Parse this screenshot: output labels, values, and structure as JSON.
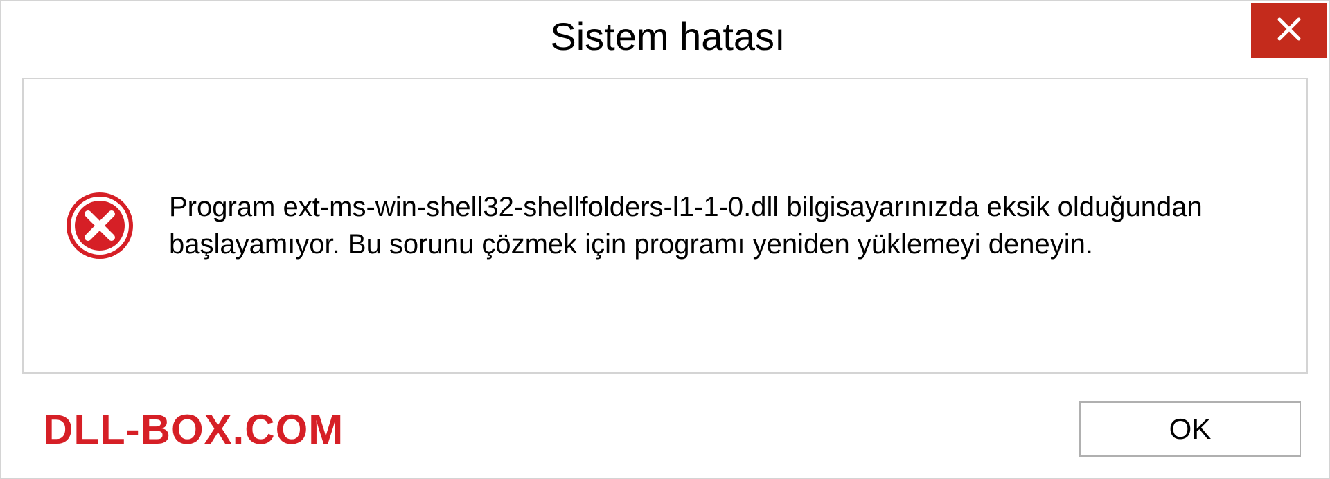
{
  "titlebar": {
    "title": "Sistem hatası"
  },
  "content": {
    "message": "Program ext-ms-win-shell32-shellfolders-l1-1-0.dll bilgisayarınızda eksik olduğundan başlayamıyor. Bu sorunu çözmek için programı yeniden yüklemeyi deneyin."
  },
  "footer": {
    "watermark": "DLL-BOX.COM",
    "ok_label": "OK"
  }
}
